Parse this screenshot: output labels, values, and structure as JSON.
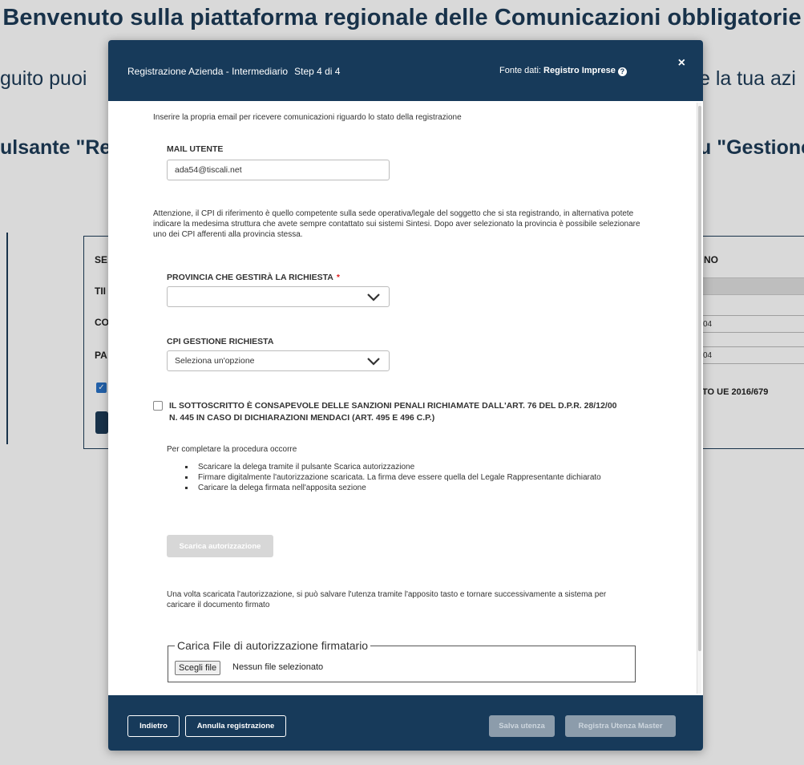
{
  "background": {
    "title": "Benvenuto sulla piattaforma regionale delle Comunicazioni obbligatorie",
    "line1_left": "guito puoi",
    "line1_right": "e la tua azi",
    "line2_left": "ulsante \"Re",
    "line2_right": "u \"Gestione",
    "labels": [
      "SE",
      "TII",
      "CO",
      "PA"
    ],
    "right_head": "NO",
    "right_rows": [
      "04",
      "04"
    ],
    "right_reg": "TO UE 2016/679"
  },
  "modal": {
    "header": {
      "title": "Registrazione Azienda - Intermediario",
      "step": "Step 4 di 4",
      "source_prefix": "Fonte dati:",
      "source_value": "Registro Imprese",
      "close_label": "×"
    },
    "intro": "Inserire la propria email per ricevere comunicazioni riguardo lo stato della registrazione",
    "email": {
      "label": "MAIL UTENTE",
      "value": "ada54@tiscali.net"
    },
    "cpi_note": "Attenzione, il CPI di riferimento è quello competente sulla sede operativa/legale del soggetto che si sta registrando, in alternativa potete indicare la medesima struttura che avete sempre contattato sui sistemi Sintesi. Dopo aver selezionato la provincia è possibile selezionare uno dei CPI afferenti alla provincia stessa.",
    "provincia": {
      "label": "PROVINCIA CHE GESTIRÀ LA RICHIESTA",
      "required": "*",
      "value": ""
    },
    "cpi": {
      "label": "CPI GESTIONE RICHIESTA",
      "value": "Seleziona un'opzione"
    },
    "declaration": "IL SOTTOSCRITTO È CONSAPEVOLE DELLE SANZIONI PENALI RICHIAMATE DALL'ART. 76 DEL D.P.R. 28/12/00 N. 445 IN CASO DI DICHIARAZIONI MENDACI (ART. 495 E 496 C.P.)",
    "procedure_intro": "Per completare la procedura occorre",
    "steps": [
      "Scaricare la delega tramite il pulsante Scarica autorizzazione",
      "Firmare digitalmente l'autorizzazione scaricata. La firma deve essere quella del Legale Rappresentante dichiarato",
      "Caricare la delega firmata nell'apposita sezione"
    ],
    "download_button": "Scarica autorizzazione",
    "after_download": "Una volta scaricata l'autorizzazione, si può salvare l'utenza tramite l'apposito tasto e tornare successivamente a sistema per caricare il documento firmato",
    "upload": {
      "legend": "Carica File di autorizzazione firmatario",
      "button": "Scegli file",
      "status": "Nessun file selezionato"
    },
    "footer": {
      "back": "Indietro",
      "cancel": "Annulla registrazione",
      "save": "Salva utenza",
      "register": "Registra Utenza Master"
    }
  }
}
